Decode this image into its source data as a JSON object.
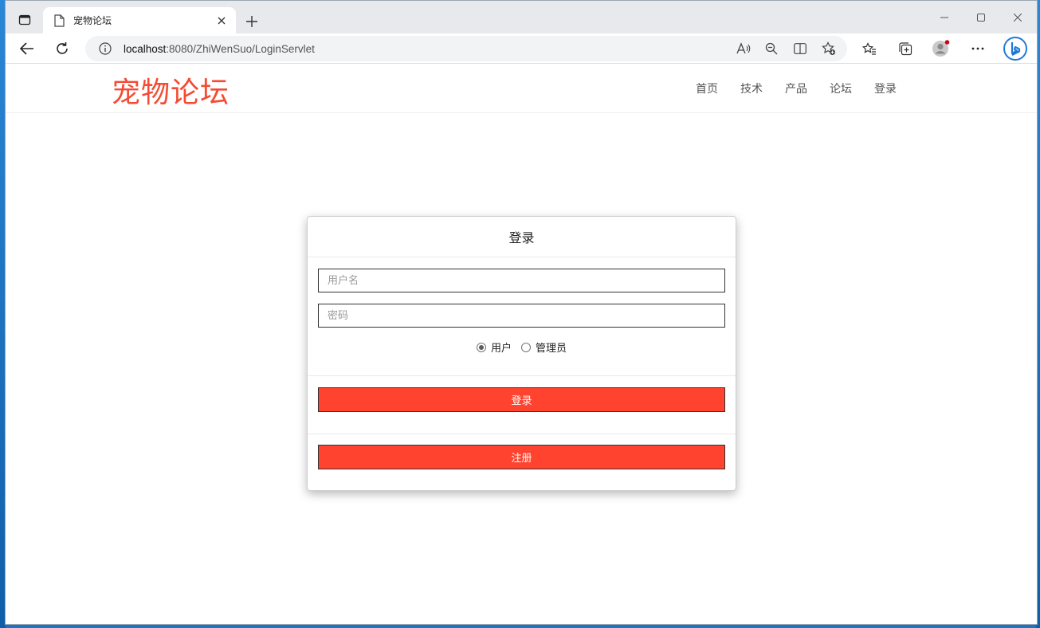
{
  "browser": {
    "tab_title": "宠物论坛",
    "url_host": "localhost",
    "url_rest": ":8080/ZhiWenSuo/LoginServlet"
  },
  "site": {
    "logo": "宠物论坛",
    "nav": [
      "首页",
      "技术",
      "产品",
      "论坛",
      "登录"
    ]
  },
  "login": {
    "title": "登录",
    "username_placeholder": "用户名",
    "password_placeholder": "密码",
    "roles": [
      {
        "label": "用户",
        "checked": true
      },
      {
        "label": "管理员",
        "checked": false
      }
    ],
    "login_button": "登录",
    "register_button": "注册"
  },
  "colors": {
    "brand": "#f44b34",
    "button": "#ff432e"
  }
}
